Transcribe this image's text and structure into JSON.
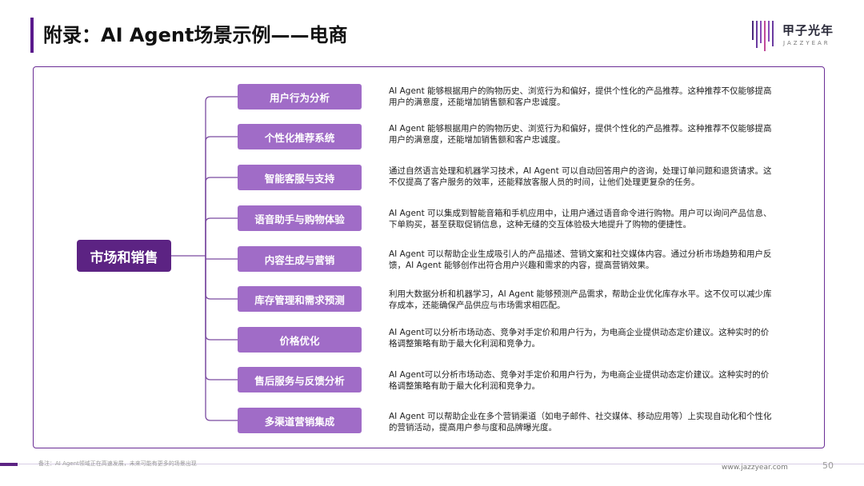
{
  "header": {
    "title": "附录：AI Agent场景示例——电商"
  },
  "logo": {
    "name": "甲子光年",
    "subtitle": "JAZZYEAR"
  },
  "diagram": {
    "root": "市场和销售",
    "items": [
      {
        "label": "用户行为分析",
        "desc": "AI Agent 能够根据用户的购物历史、浏览行为和偏好，提供个性化的产品推荐。这种推荐不仅能够提高用户的满意度，还能增加销售额和客户忠诚度。"
      },
      {
        "label": "个性化推荐系统",
        "desc": "AI Agent 能够根据用户的购物历史、浏览行为和偏好，提供个性化的产品推荐。这种推荐不仅能够提高用户的满意度，还能增加销售额和客户忠诚度。"
      },
      {
        "label": "智能客服与支持",
        "desc": "通过自然语言处理和机器学习技术，AI Agent 可以自动回答用户的咨询，处理订单问题和退货请求。这不仅提高了客户服务的效率，还能释放客服人员的时间，让他们处理更复杂的任务。"
      },
      {
        "label": "语音助手与购物体验",
        "desc": "AI Agent 可以集成到智能音箱和手机应用中，让用户通过语音命令进行购物。用户可以询问产品信息、下单购买，甚至获取促销信息，这种无缝的交互体验极大地提升了购物的便捷性。"
      },
      {
        "label": "内容生成与营销",
        "desc": "AI Agent 可以帮助企业生成吸引人的产品描述、营销文案和社交媒体内容。通过分析市场趋势和用户反馈，AI Agent 能够创作出符合用户兴趣和需求的内容，提高营销效果。"
      },
      {
        "label": "库存管理和需求预测",
        "desc": "利用大数据分析和机器学习，AI Agent 能够预测产品需求，帮助企业优化库存水平。这不仅可以减少库存成本，还能确保产品供应与市场需求相匹配。"
      },
      {
        "label": "价格优化",
        "desc": "AI Agent可以分析市场动态、竞争对手定价和用户行为，为电商企业提供动态定价建议。这种实时的价格调整策略有助于最大化利润和竞争力。"
      },
      {
        "label": "售后服务与反馈分析",
        "desc": "AI Agent可以分析市场动态、竞争对手定价和用户行为，为电商企业提供动态定价建议。这种实时的价格调整策略有助于最大化利润和竞争力。"
      },
      {
        "label": "多渠道营销集成",
        "desc": "AI Agent 可以帮助企业在多个营销渠道（如电子邮件、社交媒体、移动应用等）上实现自动化和个性化的营销活动，提高用户参与度和品牌曝光度。"
      }
    ]
  },
  "footer": {
    "note": "备注：AI Agent领域正在高速发展，未来可能有更多的场景出现",
    "website": "www.jazzyear.com",
    "page": "50"
  },
  "colors": {
    "accent": "#5c2383",
    "node": "#a06cc7",
    "frame": "#6a2d95"
  }
}
